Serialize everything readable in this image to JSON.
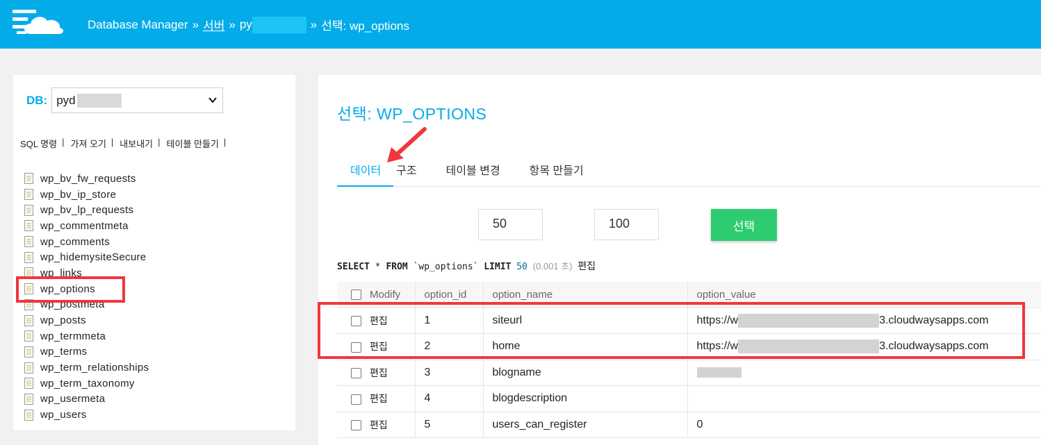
{
  "header": {
    "crumbs": [
      "Database Manager",
      "»",
      "서버",
      "»",
      "py",
      "»",
      "선택: wp_options"
    ]
  },
  "sidebar": {
    "db_label": "DB:",
    "db_value": "pyd",
    "links": [
      "SQL 명령",
      "가져 오기",
      "내보내기",
      "테이블 만들기"
    ],
    "tables": [
      "wp_bv_fw_requests",
      "wp_bv_ip_store",
      "wp_bv_lp_requests",
      "wp_commentmeta",
      "wp_comments",
      "wp_hidemysiteSecure",
      "wp_links",
      "wp_options",
      "wp_postmeta",
      "wp_posts",
      "wp_termmeta",
      "wp_terms",
      "wp_term_relationships",
      "wp_term_taxonomy",
      "wp_usermeta",
      "wp_users"
    ],
    "selected_table": "wp_options"
  },
  "main": {
    "title": "선택: WP_OPTIONS",
    "tabs": [
      "데이터",
      "구조",
      "테이블 변경",
      "항목 만들기"
    ],
    "active_tab": "데이터",
    "limit_inputs": [
      "50",
      "100"
    ],
    "select_button": "선택",
    "sql": {
      "select": "SELECT",
      "star": "*",
      "from": "FROM",
      "table": "`wp_options`",
      "limit": "LIMIT",
      "limit_value": "50",
      "time": "(0.001 초)",
      "edit": "편집"
    },
    "columns": [
      "Modify",
      "option_id",
      "option_name",
      "option_value"
    ],
    "rows": [
      {
        "edit": "편집",
        "id": "1",
        "name": "siteurl",
        "value_prefix": "https://w",
        "value_suffix": "3.cloudwaysapps.com"
      },
      {
        "edit": "편집",
        "id": "2",
        "name": "home",
        "value_prefix": "https://w",
        "value_suffix": "3.cloudwaysapps.com"
      },
      {
        "edit": "편집",
        "id": "3",
        "name": "blogname",
        "value_prefix": "",
        "value_suffix": ""
      },
      {
        "edit": "편집",
        "id": "4",
        "name": "blogdescription",
        "value_prefix": "",
        "value_suffix": ""
      },
      {
        "edit": "편집",
        "id": "5",
        "name": "users_can_register",
        "value_prefix": "0",
        "value_suffix": ""
      }
    ]
  },
  "colors": {
    "brand": "#03ace9",
    "button": "#2ecc71",
    "highlight": "#f0373d"
  }
}
